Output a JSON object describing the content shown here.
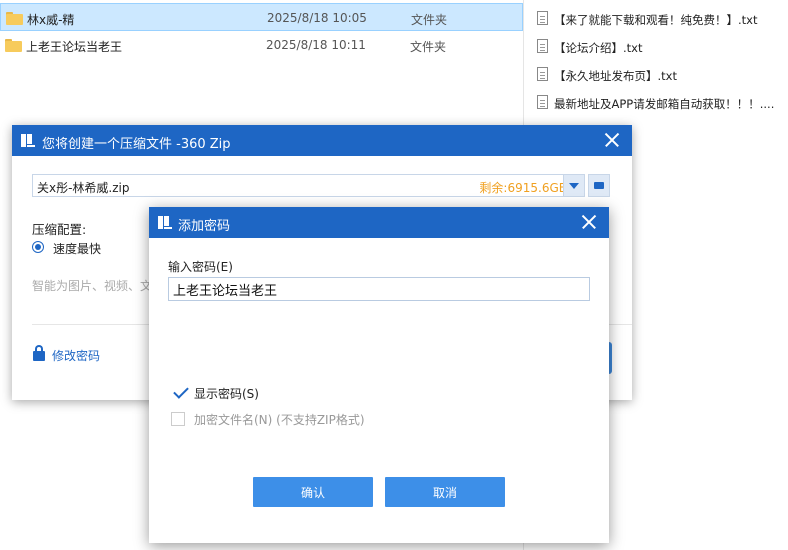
{
  "explorer": {
    "rows": [
      {
        "name": "林x威-精",
        "date": "2025/8/18 10:05",
        "type": "文件夹"
      },
      {
        "name": "上老王论坛当老王",
        "date": "2025/8/18 10:11",
        "type": "文件夹"
      }
    ],
    "txt_files": [
      "【来了就能下载和观看！纯免费！】.txt",
      "【论坛介绍】.txt",
      "【永久地址发布页】.txt",
      "最新地址及APP请发邮箱自动获取！！！...."
    ]
  },
  "zip_dialog": {
    "title": "您将创建一个压缩文件 -360 Zip",
    "path": "关x彤-林希威.zip",
    "free_space": "剩余:6915.6GB",
    "config_label": "压缩配置:",
    "option_label": "速度最快",
    "hint": "智能为图片、视频、文",
    "change_password": "修改密码"
  },
  "password_dialog": {
    "title": "添加密码",
    "input_label": "输入密码(E)",
    "input_value": "上老王论坛当老王",
    "show_password": "显示密码(S)",
    "encrypt_names": "加密文件名(N) (不支持ZIP格式)",
    "confirm": "确认",
    "cancel": "取消"
  },
  "colors": {
    "accent": "#1e66c4",
    "button": "#3d8fe8",
    "free_space": "#f0a020",
    "selection": "#cce8ff"
  }
}
